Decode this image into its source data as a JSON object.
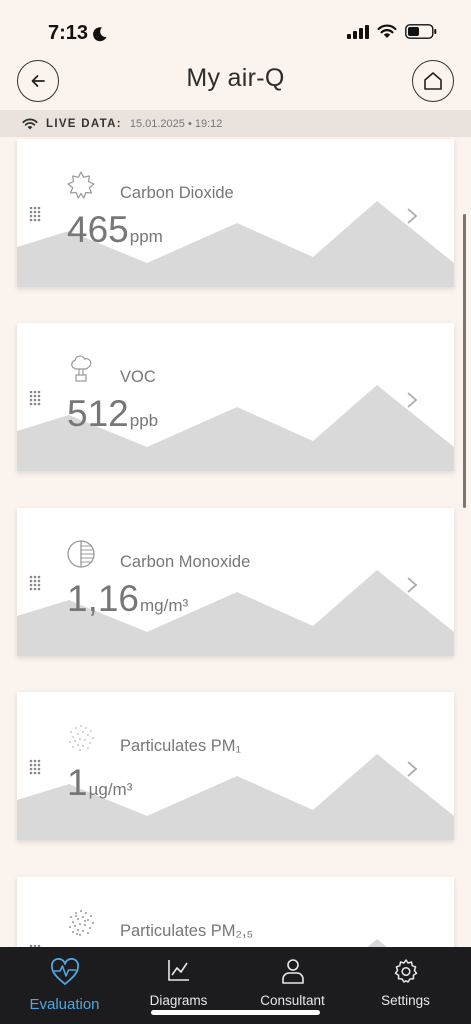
{
  "status_bar": {
    "time": "7:13"
  },
  "header": {
    "title": "My air-Q"
  },
  "live": {
    "label": "LIVE DATA:",
    "timestamp": "15.01.2025 • 19:12"
  },
  "cards": [
    {
      "name": "Carbon Dioxide",
      "value": "465",
      "unit": "ppm",
      "icon": "co2-sun-icon"
    },
    {
      "name": "VOC",
      "value": "512",
      "unit": "ppb",
      "icon": "voc-cloud-icon"
    },
    {
      "name": "Carbon Monoxide",
      "value": "1,16",
      "unit": "mg/m³",
      "icon": "co-circle-icon"
    },
    {
      "name": "Particulates PM₁",
      "value": "1",
      "unit": "µg/m³",
      "icon": "particles-icon"
    },
    {
      "name": "Particulates PM₂,₅",
      "value": "",
      "unit": "",
      "icon": "particles-dense-icon"
    }
  ],
  "nav": [
    {
      "label": "Evaluation",
      "icon": "heart-pulse-icon",
      "active": true
    },
    {
      "label": "Diagrams",
      "icon": "line-chart-icon",
      "active": false
    },
    {
      "label": "Consultant",
      "icon": "person-icon",
      "active": false
    },
    {
      "label": "Settings",
      "icon": "gear-icon",
      "active": false
    }
  ],
  "colors": {
    "accent": "#4fa7df",
    "background": "#fbf3ee",
    "nav_bg": "#1c1c1e",
    "chart_fill": "#d9d9d9"
  }
}
